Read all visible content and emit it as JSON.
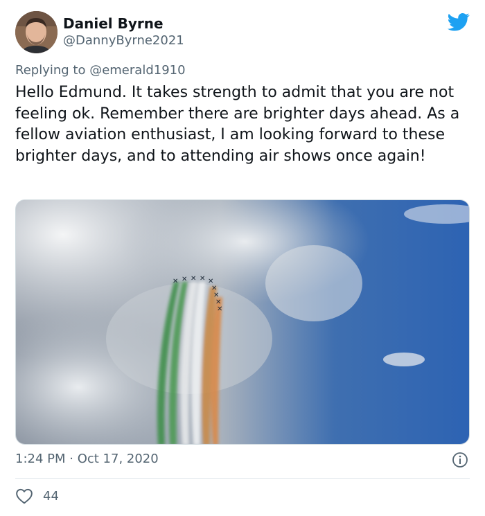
{
  "author": {
    "name": "Daniel Byrne",
    "handle": "@DannyByrne2021"
  },
  "reply": {
    "prefix": "Replying to ",
    "mention": "@emerald1910"
  },
  "tweet_text": "Hello Edmund. It takes strength to admit that you are not feeling ok. Remember there are brighter days ahead. As a fellow aviation enthusiast, I am looking forward to these brighter days, and to attending air shows once again!",
  "meta": {
    "time": "1:24 PM",
    "separator": " · ",
    "date": "Oct 17, 2020"
  },
  "likes": {
    "count": "44"
  },
  "icons": {
    "brand": "twitter-bird-icon",
    "info": "info-icon",
    "like": "heart-icon"
  },
  "colors": {
    "brand": "#1da1f2",
    "secondary_text": "#536471",
    "primary_text": "#0f1419"
  }
}
